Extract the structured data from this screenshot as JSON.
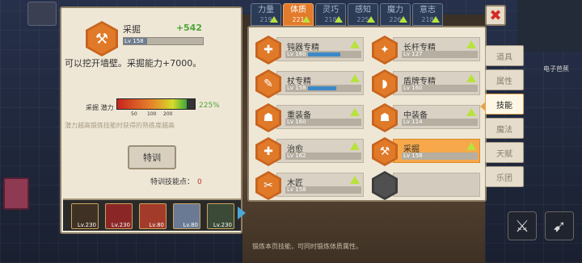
{
  "left": {
    "skill_name": "采掘",
    "skill_plus": "+542",
    "skill_level": "Lv 158",
    "description": "可以挖开墙壁。采掘能力+7000。",
    "potential_label": "采掘 潜力",
    "potential_fill": 0.9,
    "potential_pct": "225%",
    "potential_ticks": [
      "50",
      "100",
      "200"
    ],
    "hint": "潜力越高锻炼技能时获得的熟练度越高",
    "train_label": "特训",
    "train_points_label": "特训技能点：",
    "train_points_value": "0",
    "portraits": [
      {
        "lv": "Lv.230"
      },
      {
        "lv": "Lv.230"
      },
      {
        "lv": "Lv.80"
      },
      {
        "lv": "Lv.80"
      },
      {
        "lv": "Lv.230"
      }
    ]
  },
  "tabs": [
    {
      "label": "力量",
      "value": "219"
    },
    {
      "label": "体质",
      "value": "221"
    },
    {
      "label": "灵巧",
      "value": "218"
    },
    {
      "label": "感知",
      "value": "225"
    },
    {
      "label": "魔力",
      "value": "226"
    },
    {
      "label": "意志",
      "value": "218"
    }
  ],
  "skills": [
    {
      "name": "钝器专精",
      "lv": "Lv 160",
      "fill": 0.62,
      "icon": "hammer-icon",
      "glyph": "✚"
    },
    {
      "name": "长杆专精",
      "lv": "Lv 127",
      "fill": 0.0,
      "icon": "spear-icon",
      "glyph": "✦"
    },
    {
      "name": "杖专精",
      "lv": "Lv 158",
      "fill": 0.55,
      "icon": "staff-icon",
      "glyph": "✎"
    },
    {
      "name": "盾牌专精",
      "lv": "Lv 160",
      "fill": 0.0,
      "icon": "shield-icon",
      "glyph": "◗"
    },
    {
      "name": "重装备",
      "lv": "Lv 160",
      "fill": 0.0,
      "icon": "heavy-armor-icon",
      "glyph": "☗"
    },
    {
      "name": "中装备",
      "lv": "Lv 114",
      "fill": 0.0,
      "icon": "medium-armor-icon",
      "glyph": "☗"
    },
    {
      "name": "治愈",
      "lv": "Lv 162",
      "fill": 0.0,
      "icon": "heal-icon",
      "glyph": "✚"
    },
    {
      "name": "采掘",
      "lv": "Lv 158",
      "fill": 0.0,
      "icon": "pickaxe-icon",
      "glyph": "⚒"
    },
    {
      "name": "木匠",
      "lv": "Lv 158",
      "fill": 0.0,
      "icon": "saw-icon",
      "glyph": "✂"
    },
    {
      "name": "",
      "lv": "",
      "fill": 0.0,
      "icon": "empty-slot-icon",
      "glyph": ""
    }
  ],
  "side_menu": [
    "道具",
    "属性",
    "技能",
    "魔法",
    "天赋",
    "乐团"
  ],
  "status_text": "锻炼本页技能，可同时锻炼体质属性。",
  "sign_text": "电子芭蕉",
  "colors": {
    "accent": "#e27b2b",
    "panel": "#efe7d6",
    "tab_bg": "#2c3c57",
    "up_arrow": "#b8e23c",
    "level_bar": "#3d89c7"
  }
}
